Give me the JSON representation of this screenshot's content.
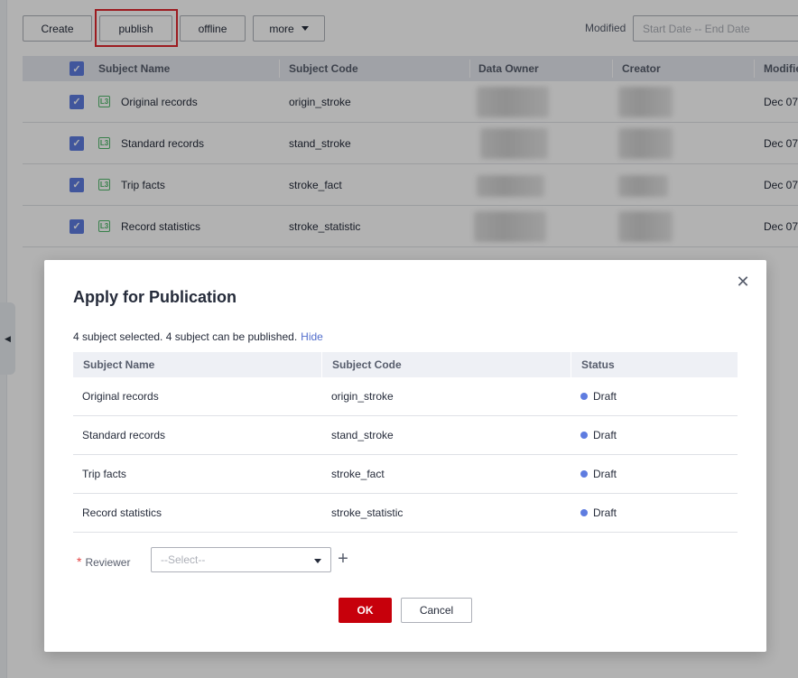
{
  "toolbar": {
    "create_label": "Create",
    "publish_label": "publish",
    "offline_label": "offline",
    "more_label": "more",
    "modified_label": "Modified",
    "date_placeholder": "Start Date -- End Date"
  },
  "grid": {
    "columns": [
      "Subject Name",
      "Subject Code",
      "Data Owner",
      "Creator",
      "Modified"
    ],
    "rows": [
      {
        "name": "Original records",
        "code": "origin_stroke",
        "modified": "Dec 07"
      },
      {
        "name": "Standard records",
        "code": "stand_stroke",
        "modified": "Dec 07"
      },
      {
        "name": "Trip facts",
        "code": "stroke_fact",
        "modified": "Dec 07"
      },
      {
        "name": "Record statistics",
        "code": "stroke_statistic",
        "modified": "Dec 07"
      }
    ],
    "row_icon": "L3"
  },
  "dialog": {
    "title": "Apply for Publication",
    "summary": "4 subject selected. 4 subject can be published.",
    "hide_link": "Hide",
    "columns": [
      "Subject Name",
      "Subject Code",
      "Status"
    ],
    "rows": [
      {
        "name": "Original records",
        "code": "origin_stroke",
        "status": "Draft"
      },
      {
        "name": "Standard records",
        "code": "stand_stroke",
        "status": "Draft"
      },
      {
        "name": "Trip facts",
        "code": "stroke_fact",
        "status": "Draft"
      },
      {
        "name": "Record statistics",
        "code": "stroke_statistic",
        "status": "Draft"
      }
    ],
    "reviewer_label": "Reviewer",
    "required_mark": "*",
    "reviewer_placeholder": "--Select--",
    "ok_label": "OK",
    "cancel_label": "Cancel"
  },
  "icons": {
    "close": "close-icon",
    "plus": "plus-icon",
    "collapse": "collapse-left-icon",
    "check": "checkmark-icon"
  },
  "colors": {
    "accent": "#5e7ce0",
    "primary_button": "#c7000b",
    "highlight_border": "#e0282e",
    "status_dot": "#5e7ce0"
  }
}
